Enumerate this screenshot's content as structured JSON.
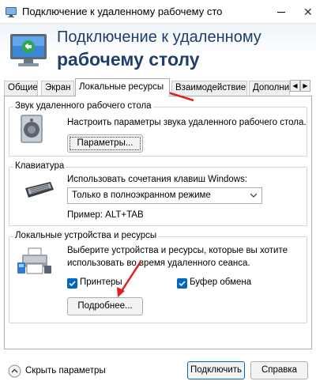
{
  "window": {
    "title": "Подключение к удаленному рабочему сто",
    "close_glyph": "✕"
  },
  "banner": {
    "line1": "Подключение к удаленному",
    "line2": "рабочему столу"
  },
  "tabs": [
    {
      "label": "Общие",
      "active": false
    },
    {
      "label": "Экран",
      "active": false
    },
    {
      "label": "Локальные ресурсы",
      "active": true
    },
    {
      "label": "Взаимодействие",
      "active": false
    },
    {
      "label": "Дополнит",
      "active": false
    }
  ],
  "tab_scroll": {
    "left": "◀",
    "right": "▶"
  },
  "sound": {
    "group_label": "Звук удаленного рабочего стола",
    "description": "Настроить параметры звука удаленного рабочего стола.",
    "button": "Параметры..."
  },
  "keyboard": {
    "group_label": "Клавиатура",
    "description": "Использовать сочетания клавиш Windows:",
    "selected": "Только в полноэкранном режиме",
    "example": "Пример: ALT+TAB"
  },
  "devices": {
    "group_label": "Локальные устройства и ресурсы",
    "description_line1": "Выберите устройства и ресурсы, которые вы хотите",
    "description_line2": "использовать во время удаленного сеанса.",
    "printers": {
      "label": "Принтеры",
      "checked": true
    },
    "clipboard": {
      "label": "Буфер обмена",
      "checked": true
    },
    "more_button": "Подробнее..."
  },
  "footer": {
    "hide_options": "Скрыть параметры",
    "connect": "Подключить",
    "help": "Справка"
  },
  "colors": {
    "accent": "#0067c0",
    "heading": "#1e3f6e",
    "annotation_arrow": "#e02020"
  }
}
